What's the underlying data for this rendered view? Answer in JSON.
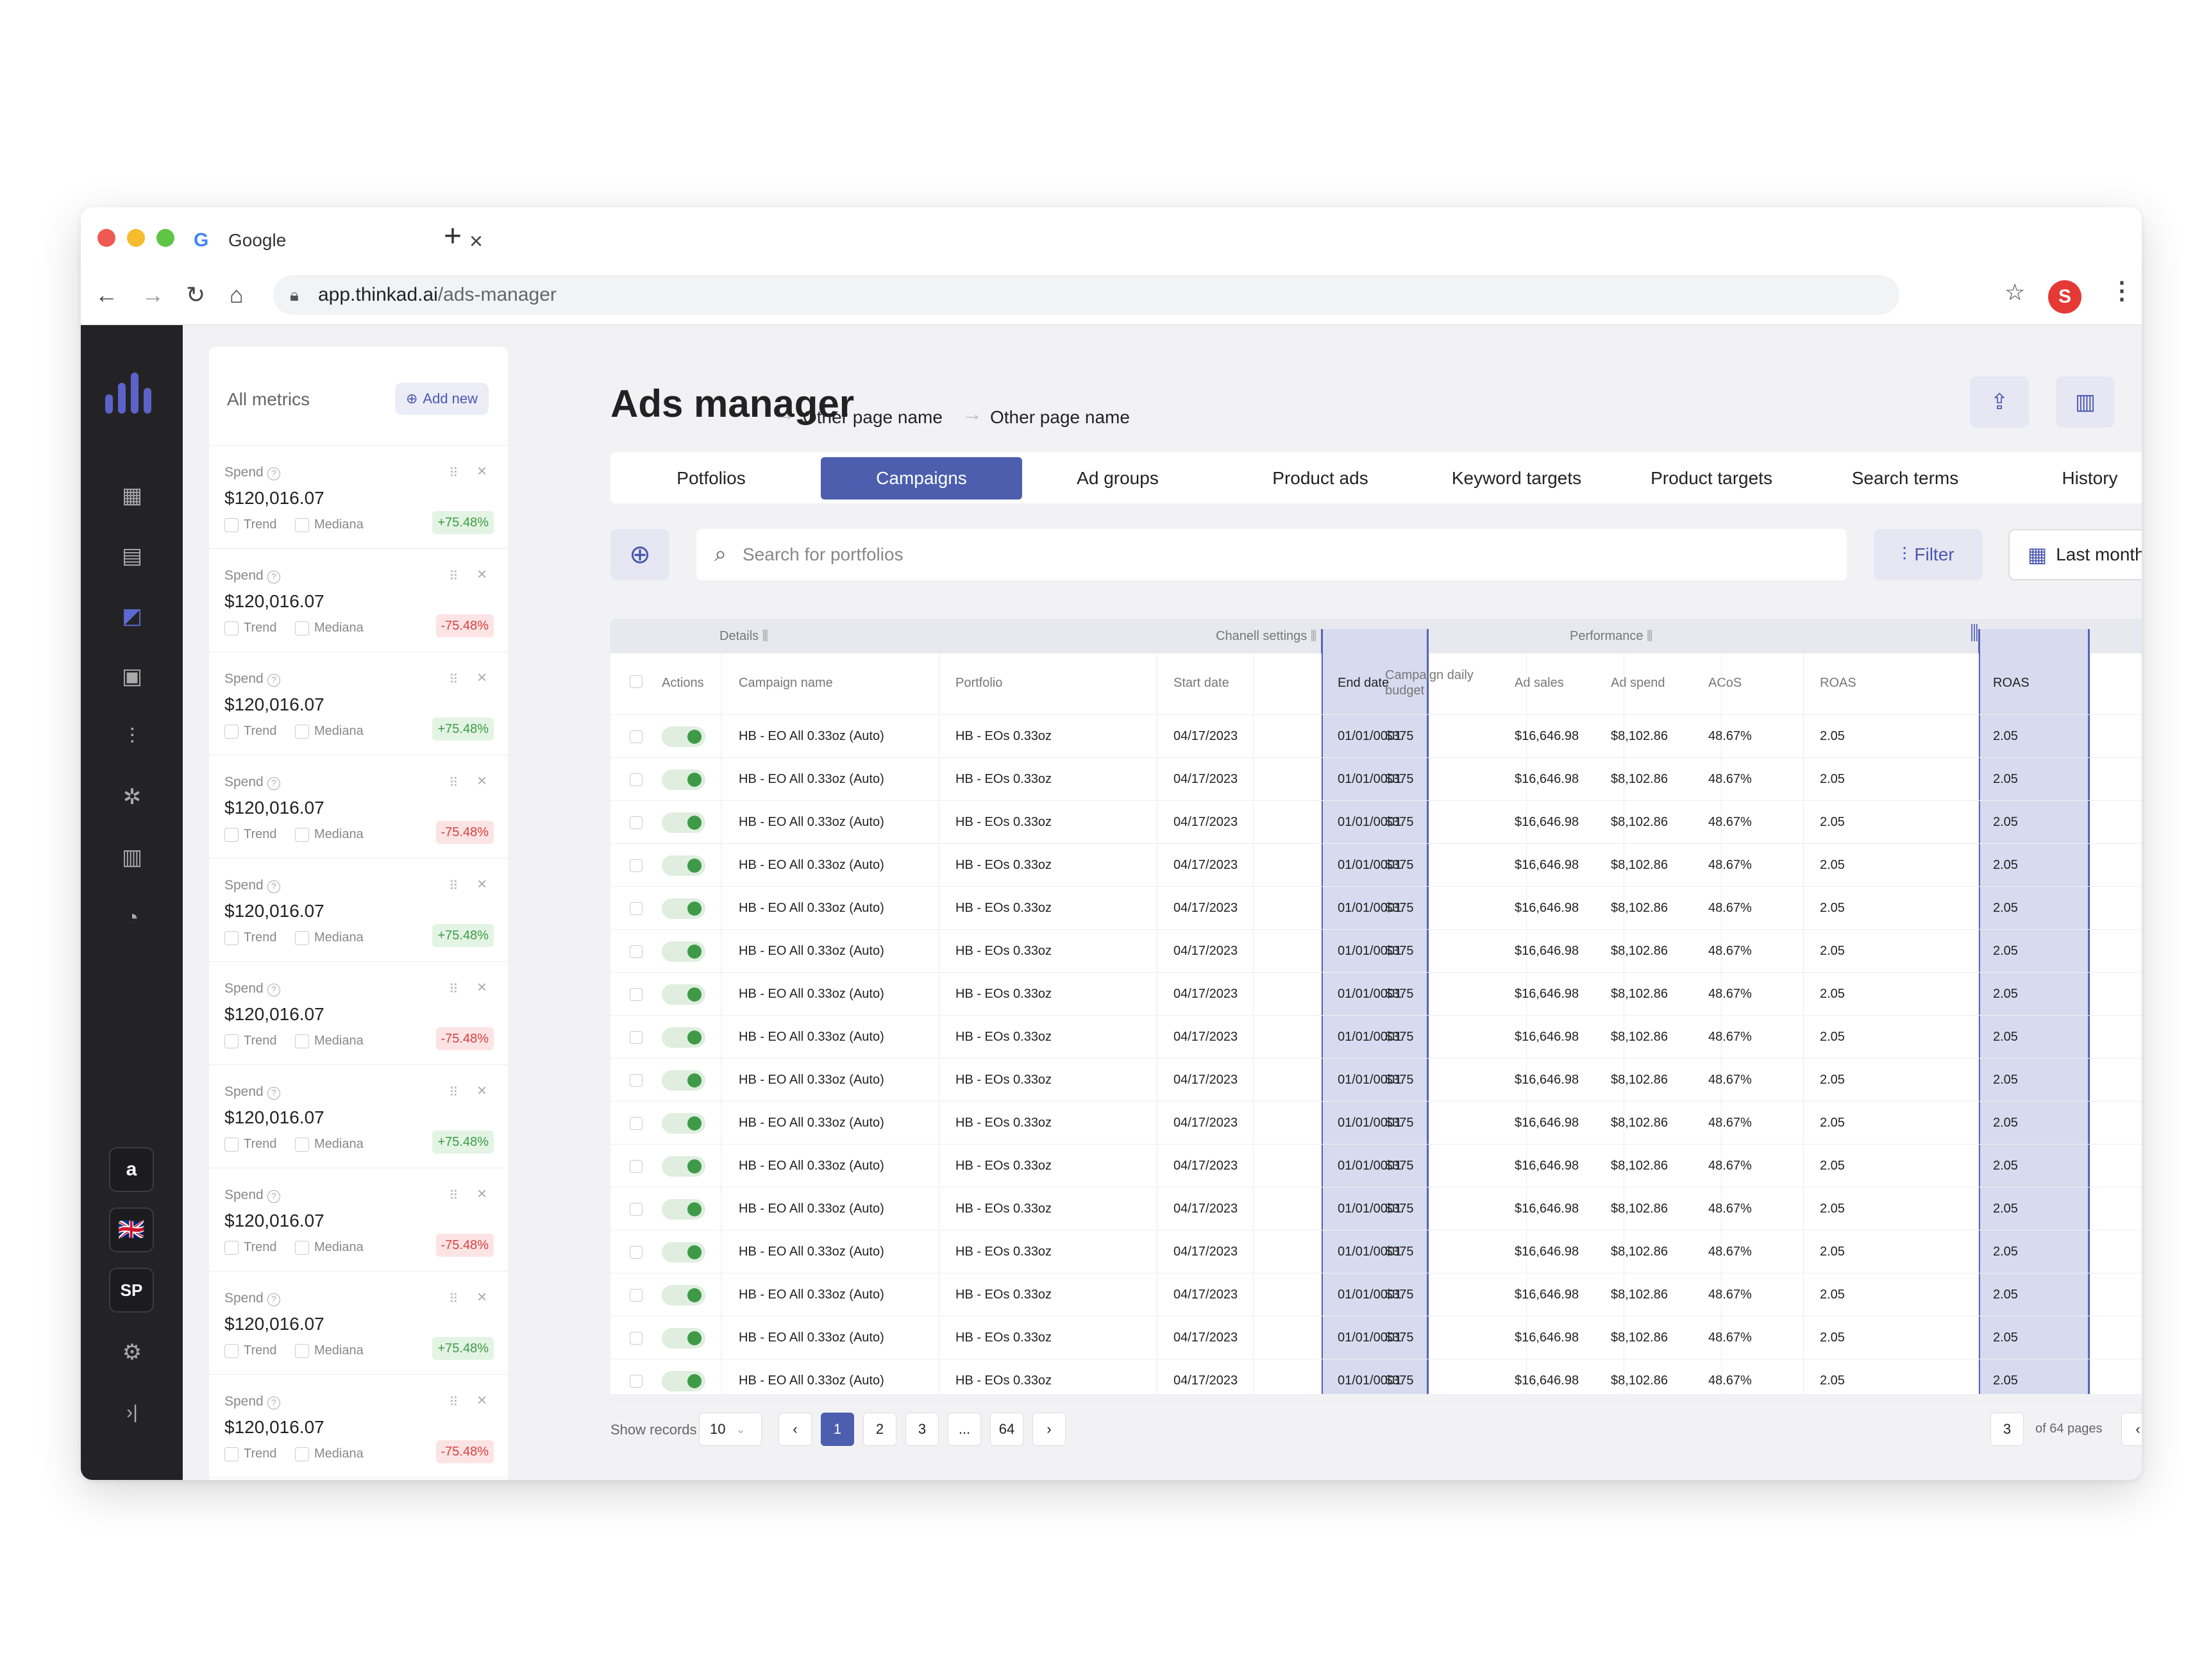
{
  "browser": {
    "tab_title": "Google",
    "url_host": "app.thinkad.ai",
    "url_path": "/ads-manager",
    "profile_initial": "S"
  },
  "colors": {
    "accent": "#4c5ead",
    "sidebar": "#232325",
    "positive": "#3e9a46",
    "negative": "#d84040"
  },
  "sidebar": {
    "icons": [
      "dashboard-icon",
      "clipboard-icon",
      "trend-chart-icon",
      "archive-icon",
      "growth-icon",
      "network-icon",
      "bar-chart-icon",
      "pie-chart-icon"
    ],
    "amazon_label": "a",
    "flag_label": "🇬🇧",
    "sp_label": "SP"
  },
  "metrics_panel": {
    "title": "All metrics",
    "add_new": "Add new",
    "cards": [
      {
        "label": "Spend",
        "value": "$120,016.07",
        "trend": "Trend",
        "mediana": "Mediana",
        "change": "+75.48%",
        "dir": "up"
      },
      {
        "label": "Spend",
        "value": "$120,016.07",
        "trend": "Trend",
        "mediana": "Mediana",
        "change": "-75.48%",
        "dir": "down"
      },
      {
        "label": "Spend",
        "value": "$120,016.07",
        "trend": "Trend",
        "mediana": "Mediana",
        "change": "+75.48%",
        "dir": "up"
      },
      {
        "label": "Spend",
        "value": "$120,016.07",
        "trend": "Trend",
        "mediana": "Mediana",
        "change": "-75.48%",
        "dir": "down"
      },
      {
        "label": "Spend",
        "value": "$120,016.07",
        "trend": "Trend",
        "mediana": "Mediana",
        "change": "+75.48%",
        "dir": "up"
      },
      {
        "label": "Spend",
        "value": "$120,016.07",
        "trend": "Trend",
        "mediana": "Mediana",
        "change": "-75.48%",
        "dir": "down"
      },
      {
        "label": "Spend",
        "value": "$120,016.07",
        "trend": "Trend",
        "mediana": "Mediana",
        "change": "+75.48%",
        "dir": "up"
      },
      {
        "label": "Spend",
        "value": "$120,016.07",
        "trend": "Trend",
        "mediana": "Mediana",
        "change": "-75.48%",
        "dir": "down"
      },
      {
        "label": "Spend",
        "value": "$120,016.07",
        "trend": "Trend",
        "mediana": "Mediana",
        "change": "+75.48%",
        "dir": "up"
      },
      {
        "label": "Spend",
        "value": "$120,016.07",
        "trend": "Trend",
        "mediana": "Mediana",
        "change": "-75.48%",
        "dir": "down"
      }
    ]
  },
  "header": {
    "title": "Ads manager",
    "crumbs": [
      "Other page name",
      "Other page name"
    ]
  },
  "tabs": [
    "Potfolios",
    "Campaigns",
    "Ad groups",
    "Product ads",
    "Keyword targets",
    "Product targets",
    "Search terms",
    "History"
  ],
  "active_tab": "Campaigns",
  "toolbar": {
    "search_placeholder": "Search for portfolios",
    "filter_label": "Filter",
    "period_label": "Last month"
  },
  "table": {
    "groups": [
      "Details",
      "Chanell settings",
      "Performance"
    ],
    "columns": [
      "Actions",
      "Campaign name",
      "Portfolio",
      "Start date",
      "End date",
      "Campaign daily budget",
      "Ad sales",
      "Ad spend",
      "ACoS",
      "ROAS",
      "ROAS"
    ],
    "rows": [
      [
        "HB - EO All 0.33oz (Auto)",
        "HB - EOs 0.33oz",
        "04/17/2023",
        "01/01/0001",
        "$375",
        "$16,646.98",
        "$8,102.86",
        "48.67%",
        "2.05",
        "2.05"
      ],
      [
        "HB - EO All 0.33oz (Auto)",
        "HB - EOs 0.33oz",
        "04/17/2023",
        "01/01/0001",
        "$375",
        "$16,646.98",
        "$8,102.86",
        "48.67%",
        "2.05",
        "2.05"
      ],
      [
        "HB - EO All 0.33oz (Auto)",
        "HB - EOs 0.33oz",
        "04/17/2023",
        "01/01/0001",
        "$375",
        "$16,646.98",
        "$8,102.86",
        "48.67%",
        "2.05",
        "2.05"
      ],
      [
        "HB - EO All 0.33oz (Auto)",
        "HB - EOs 0.33oz",
        "04/17/2023",
        "01/01/0001",
        "$375",
        "$16,646.98",
        "$8,102.86",
        "48.67%",
        "2.05",
        "2.05"
      ],
      [
        "HB - EO All 0.33oz (Auto)",
        "HB - EOs 0.33oz",
        "04/17/2023",
        "01/01/0001",
        "$375",
        "$16,646.98",
        "$8,102.86",
        "48.67%",
        "2.05",
        "2.05"
      ],
      [
        "HB - EO All 0.33oz (Auto)",
        "HB - EOs 0.33oz",
        "04/17/2023",
        "01/01/0001",
        "$375",
        "$16,646.98",
        "$8,102.86",
        "48.67%",
        "2.05",
        "2.05"
      ],
      [
        "HB - EO All 0.33oz (Auto)",
        "HB - EOs 0.33oz",
        "04/17/2023",
        "01/01/0001",
        "$375",
        "$16,646.98",
        "$8,102.86",
        "48.67%",
        "2.05",
        "2.05"
      ],
      [
        "HB - EO All 0.33oz (Auto)",
        "HB - EOs 0.33oz",
        "04/17/2023",
        "01/01/0001",
        "$375",
        "$16,646.98",
        "$8,102.86",
        "48.67%",
        "2.05",
        "2.05"
      ],
      [
        "HB - EO All 0.33oz (Auto)",
        "HB - EOs 0.33oz",
        "04/17/2023",
        "01/01/0001",
        "$375",
        "$16,646.98",
        "$8,102.86",
        "48.67%",
        "2.05",
        "2.05"
      ],
      [
        "HB - EO All 0.33oz (Auto)",
        "HB - EOs 0.33oz",
        "04/17/2023",
        "01/01/0001",
        "$375",
        "$16,646.98",
        "$8,102.86",
        "48.67%",
        "2.05",
        "2.05"
      ],
      [
        "HB - EO All 0.33oz (Auto)",
        "HB - EOs 0.33oz",
        "04/17/2023",
        "01/01/0001",
        "$375",
        "$16,646.98",
        "$8,102.86",
        "48.67%",
        "2.05",
        "2.05"
      ],
      [
        "HB - EO All 0.33oz (Auto)",
        "HB - EOs 0.33oz",
        "04/17/2023",
        "01/01/0001",
        "$375",
        "$16,646.98",
        "$8,102.86",
        "48.67%",
        "2.05",
        "2.05"
      ],
      [
        "HB - EO All 0.33oz (Auto)",
        "HB - EOs 0.33oz",
        "04/17/2023",
        "01/01/0001",
        "$375",
        "$16,646.98",
        "$8,102.86",
        "48.67%",
        "2.05",
        "2.05"
      ],
      [
        "HB - EO All 0.33oz (Auto)",
        "HB - EOs 0.33oz",
        "04/17/2023",
        "01/01/0001",
        "$375",
        "$16,646.98",
        "$8,102.86",
        "48.67%",
        "2.05",
        "2.05"
      ],
      [
        "HB - EO All 0.33oz (Auto)",
        "HB - EOs 0.33oz",
        "04/17/2023",
        "01/01/0001",
        "$375",
        "$16,646.98",
        "$8,102.86",
        "48.67%",
        "2.05",
        "2.05"
      ],
      [
        "HB - EO All 0.33oz (Auto)",
        "HB - EOs 0.33oz",
        "04/17/2023",
        "01/01/0001",
        "$375",
        "$16,646.98",
        "$8,102.86",
        "48.67%",
        "2.05",
        "2.05"
      ]
    ]
  },
  "pagination": {
    "show_records_label": "Show records",
    "records_value": "10",
    "pages": [
      "1",
      "2",
      "3",
      "...",
      "64"
    ],
    "current_page": "1",
    "goto_value": "3",
    "of_pages": "of 64 pages"
  }
}
